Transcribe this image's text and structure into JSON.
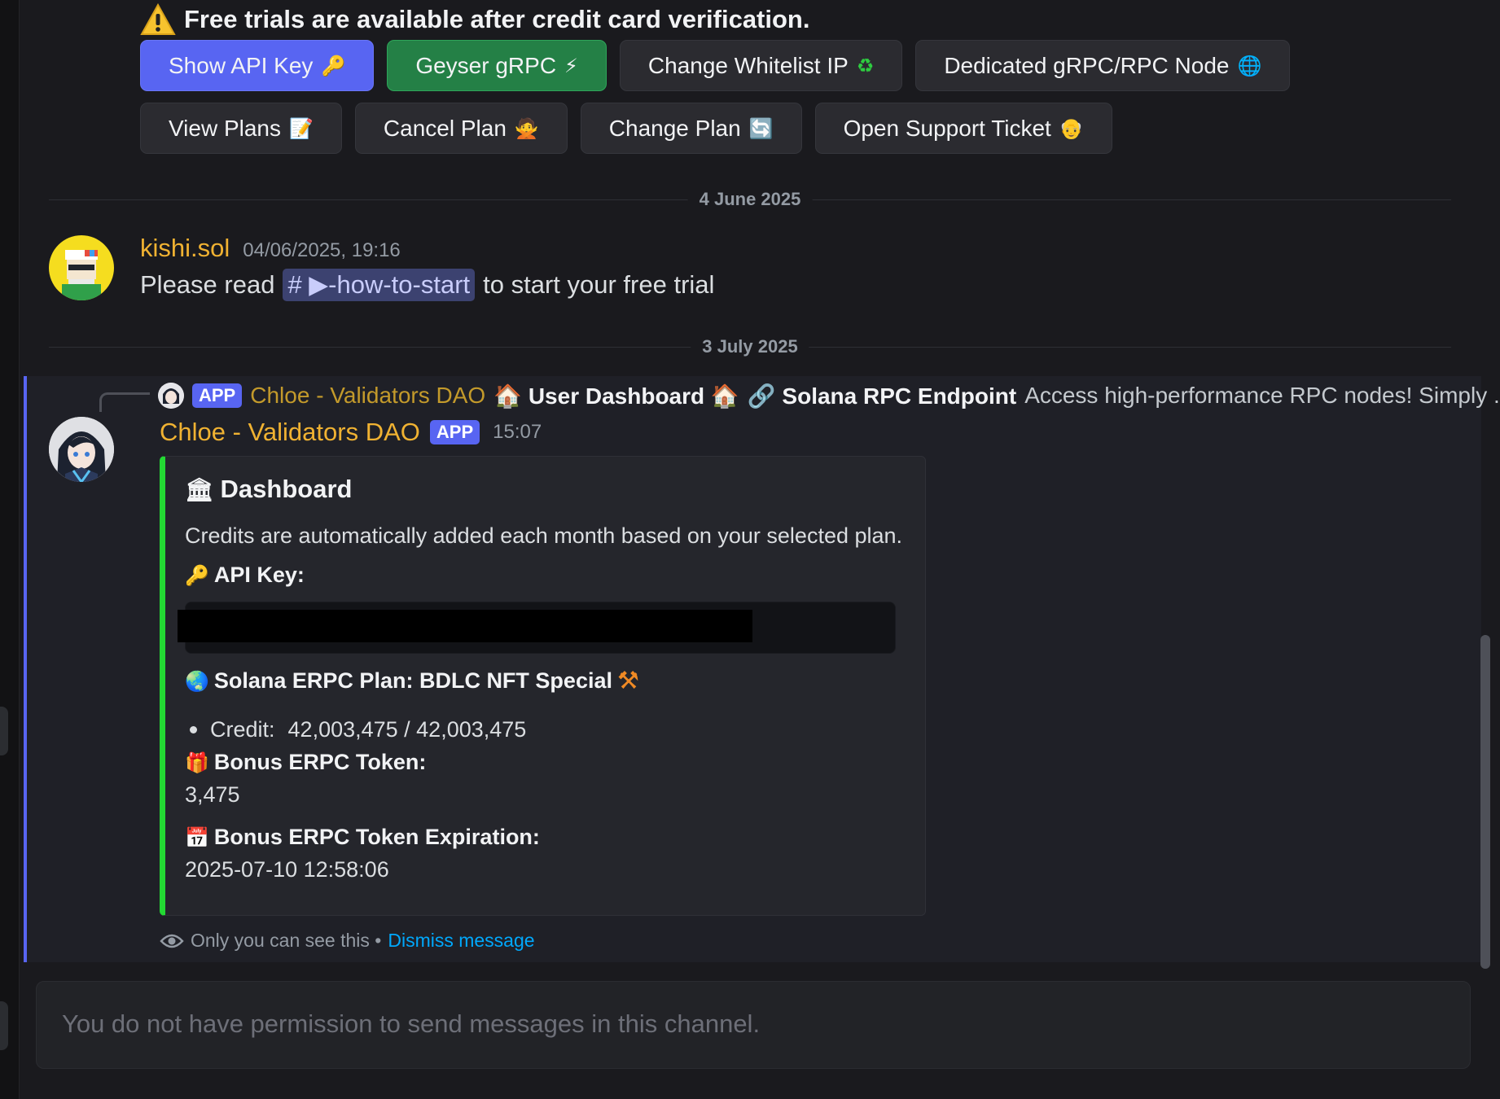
{
  "banner": {
    "icon": "warning-icon",
    "text": "Free trials are available after credit card verification."
  },
  "buttons_row1": [
    {
      "label": "Show API Key",
      "emoji": "🔑",
      "style": "primary"
    },
    {
      "label": "Geyser gRPC",
      "emoji": "⚡",
      "style": "success"
    },
    {
      "label": "Change Whitelist IP",
      "emoji": "♻",
      "style": "secondary"
    },
    {
      "label": "Dedicated gRPC/RPC Node",
      "emoji": "🌐",
      "style": "secondary"
    }
  ],
  "buttons_row2": [
    {
      "label": "View Plans",
      "emoji": "📝"
    },
    {
      "label": "Cancel Plan",
      "emoji": "🙅"
    },
    {
      "label": "Change Plan",
      "emoji": "🔄"
    },
    {
      "label": "Open Support Ticket",
      "emoji": "👴"
    }
  ],
  "dividers": {
    "first": "4 June 2025",
    "second": "3 July 2025"
  },
  "message1": {
    "author": "kishi.sol",
    "timestamp": "04/06/2025, 19:16",
    "text_before": "Please read",
    "channel_mention": "# ▶-how-to-start",
    "text_after": "to start your free trial"
  },
  "reply": {
    "tag": "APP",
    "author": "Chloe - Validators DAO",
    "command": "🏠 User Dashboard 🏠",
    "link_title": "🔗 Solana RPC Endpoint",
    "preview": "Access high-performance RPC nodes! Simply ..."
  },
  "message2": {
    "author": "Chloe - Validators DAO",
    "tag": "APP",
    "timestamp": "15:07"
  },
  "embed": {
    "accent": "#23d933",
    "title": "Dashboard",
    "title_emoji": "🏛",
    "description": "Credits are automatically added each month based on your selected plan.",
    "api_key_label": "API Key:",
    "api_key_emoji": "🔑",
    "plan_label": "Solana ERPC Plan: BDLC NFT Special",
    "plan_emoji": "🌏",
    "plan_trailing_emoji": "⚒",
    "credit_label": "Credit:",
    "credit_value": "42,003,475 / 42,003,475",
    "bonus_label": "Bonus ERPC Token:",
    "bonus_emoji": "🎁",
    "bonus_value": "3,475",
    "expiration_label": "Bonus ERPC Token Expiration:",
    "expiration_emoji": "📅",
    "expiration_value": "2025-07-10 12:58:06"
  },
  "notice": {
    "text": "Only you can see this •",
    "dismiss": "Dismiss message"
  },
  "composer": {
    "placeholder": "You do not have permission to send messages in this channel."
  },
  "colors": {
    "blurple": "#5865f2",
    "green": "#248046",
    "author_gold": "#f0b232",
    "link": "#00a8fc"
  }
}
